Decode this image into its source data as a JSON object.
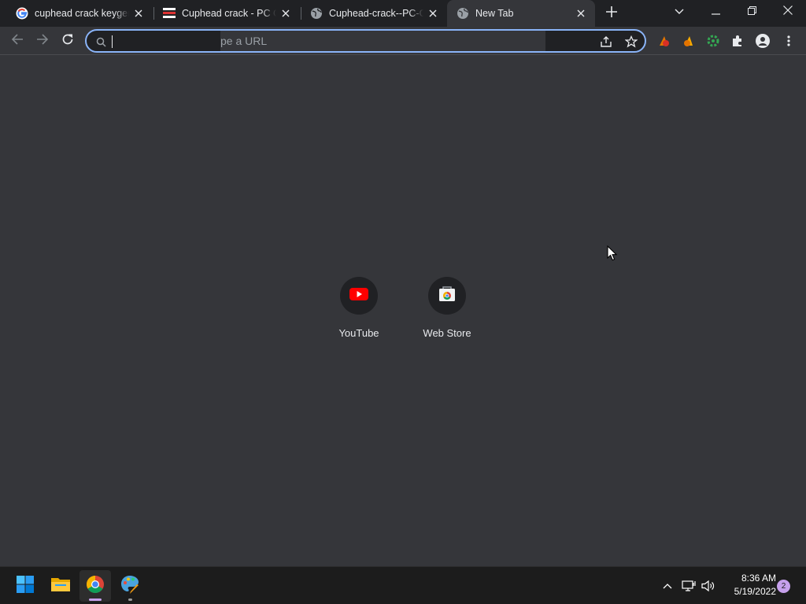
{
  "browser": {
    "tabs": [
      {
        "title": "cuphead crack keygen",
        "favicon": "google-g-icon",
        "active": false
      },
      {
        "title": "Cuphead crack - PC Ga",
        "favicon": "site-flag-icon",
        "active": false
      },
      {
        "title": "Cuphead-crack--PC-Ga",
        "favicon": "globe-icon",
        "active": false
      },
      {
        "title": "New Tab",
        "favicon": "globe-icon",
        "active": true
      }
    ],
    "omnibox": {
      "value": "",
      "placeholder_visible": "pe a URL"
    }
  },
  "new_tab": {
    "shortcuts": [
      {
        "label": "YouTube",
        "icon": "youtube-icon"
      },
      {
        "label": "Web Store",
        "icon": "chrome-web-store-icon"
      }
    ]
  },
  "taskbar": {
    "apps": [
      "windows-start-icon",
      "file-explorer-icon",
      "chrome-icon",
      "paint-icon"
    ],
    "clock": {
      "time": "8:36 AM",
      "date": "5/19/2022"
    },
    "notification_count": "2"
  },
  "colors": {
    "accent": "#8ab4f8",
    "tabstrip_bg": "#202124",
    "content_bg": "#35363a",
    "taskbar_bg": "#1c1c1c",
    "youtube_red": "#ff0000",
    "windows_blue": "#0078d4"
  }
}
